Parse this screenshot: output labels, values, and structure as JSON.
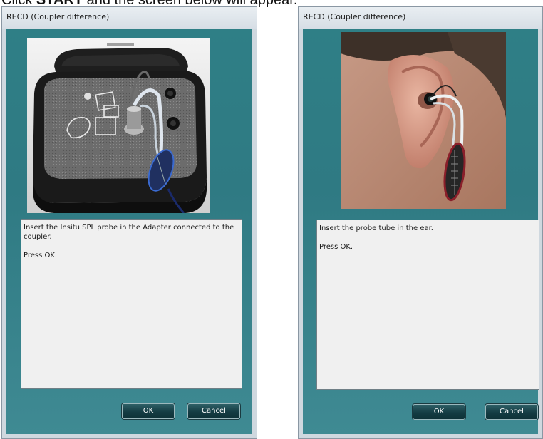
{
  "caption": {
    "prefix": "Click ",
    "bold": "START",
    "suffix": " and the screen below will appear."
  },
  "dialogs": [
    {
      "title": "RECD (Coupler difference)",
      "image_subject": "coupler-photo",
      "lines": [
        "Insert the Insitu SPL probe in the Adapter connected to the coupler.",
        "Press OK."
      ],
      "ok_label": "OK",
      "cancel_label": "Cancel"
    },
    {
      "title": "RECD (Coupler difference)",
      "image_subject": "ear-probe-photo",
      "lines": [
        "Insert the probe tube in the ear.",
        "Press OK."
      ],
      "ok_label": "OK",
      "cancel_label": "Cancel"
    }
  ],
  "colors": {
    "panel": "#2f7f86",
    "button": "#143c43",
    "textbox": "#f0f0f0"
  }
}
